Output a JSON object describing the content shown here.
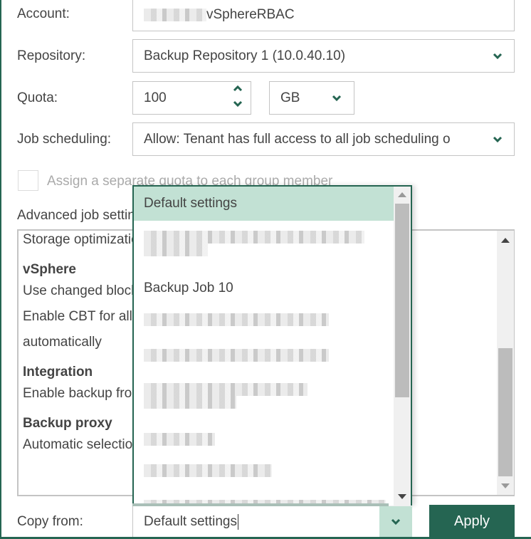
{
  "form": {
    "account": {
      "label": "Account:",
      "value_suffix": "vSphereRBAC"
    },
    "repository": {
      "label": "Repository:",
      "value": "Backup Repository 1 (10.0.40.10)"
    },
    "quota": {
      "label": "Quota:",
      "value": "100",
      "unit": "GB"
    },
    "job_scheduling": {
      "label": "Job scheduling:",
      "value": "Allow: Tenant has full access to all job scheduling o"
    },
    "separate_quota": {
      "label": "Assign a separate quota to each group member",
      "checked": false,
      "disabled": true
    },
    "advanced": {
      "label": "Advanced job settings:",
      "lines": [
        {
          "text": "Storage optimization: Local target",
          "bold": false
        },
        {
          "text": "vSphere",
          "bold": true
        },
        {
          "text": "Use changed block tracking data",
          "bold": false
        },
        {
          "text": "Enable CBT for all processed VMs",
          "bold": false
        },
        {
          "text": "automatically",
          "bold": false
        },
        {
          "text": "Integration",
          "bold": true
        },
        {
          "text": "Enable backup from storage snapshots",
          "bold": false
        },
        {
          "text": "Backup proxy",
          "bold": true
        },
        {
          "text": "Automatic selection",
          "bold": false
        }
      ]
    },
    "copy_from": {
      "label": "Copy from:",
      "value": "Default settings",
      "options": [
        {
          "label": "Default settings",
          "selected": true
        },
        {
          "label": "",
          "blurred": true
        },
        {
          "label": "Backup Job 10"
        },
        {
          "label": "",
          "blurred": true
        },
        {
          "label": "",
          "blurred": true
        },
        {
          "label": "",
          "blurred": true
        },
        {
          "label": "",
          "blurred": true
        },
        {
          "label": "",
          "blurred": true
        },
        {
          "label": "",
          "blurred": true
        }
      ]
    },
    "apply_label": "Apply"
  },
  "colors": {
    "accent": "#256552",
    "selection": "#c2e1d4"
  }
}
